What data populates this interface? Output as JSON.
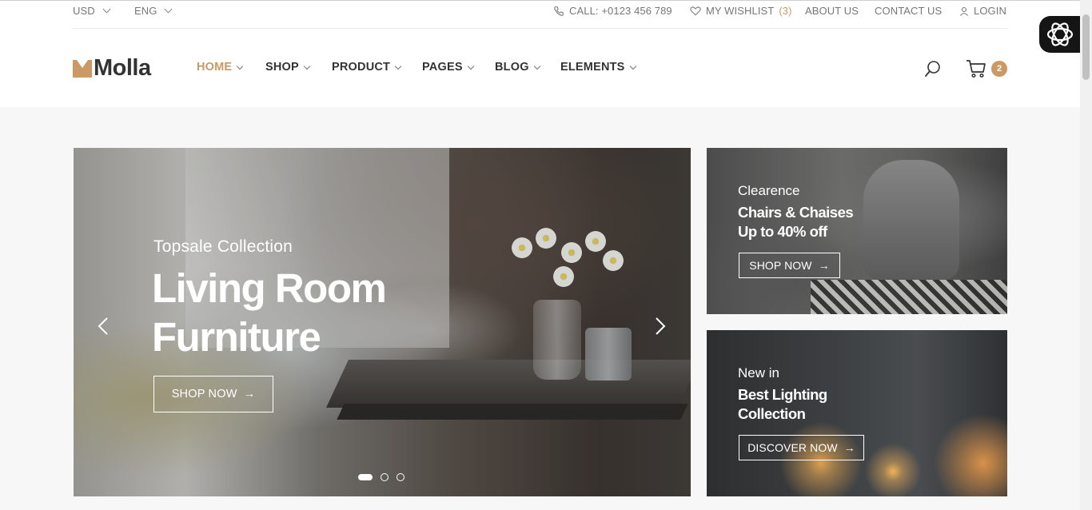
{
  "topbar": {
    "currency": "USD",
    "language": "ENG",
    "call": "CALL: +0123 456 789",
    "wishlist_label": "MY WISHLIST",
    "wishlist_count": "(3)",
    "about": "ABOUT US",
    "contact": "CONTACT US",
    "login": "LOGIN"
  },
  "header": {
    "logo_text": "Molla",
    "nav": [
      {
        "label": "HOME",
        "active": true
      },
      {
        "label": "SHOP"
      },
      {
        "label": "PRODUCT"
      },
      {
        "label": "PAGES"
      },
      {
        "label": "BLOG"
      },
      {
        "label": "ELEMENTS"
      }
    ],
    "cart_count": "2",
    "accent": "#cc9966"
  },
  "hero": {
    "subtitle": "Topsale Collection",
    "title_line1": "Living Room",
    "title_line2": "Furniture",
    "button": "SHOP NOW",
    "active_slide": 1,
    "slide_count": 3
  },
  "banners": [
    {
      "subtitle": "Clearence",
      "title_line1": "Chairs & Chaises",
      "title_line2": "Up to 40% off",
      "button": "SHOP NOW"
    },
    {
      "subtitle": "New in",
      "title_line1": "Best Lighting",
      "title_line2": "Collection",
      "button": "DISCOVER NOW"
    }
  ],
  "icons": {
    "arrow": "→"
  }
}
